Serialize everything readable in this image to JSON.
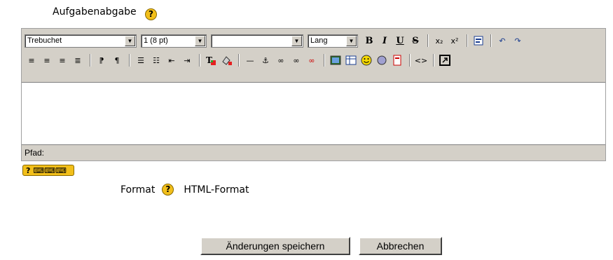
{
  "field": {
    "label": "Aufgabenabgabe",
    "help_icon": "?"
  },
  "toolbar": {
    "font_family": "Trebuchet",
    "font_size": "1 (8 pt)",
    "heading": "",
    "lang": "Lang",
    "bold": "B",
    "italic": "I",
    "underline": "U",
    "strike": "S",
    "subscript": "x₂",
    "superscript": "x²"
  },
  "editor": {
    "path_label": "Pfad:"
  },
  "keyboard_help": {
    "label": "? ⌨⌨⌨"
  },
  "format": {
    "label": "Format",
    "help_icon": "?",
    "value": "HTML-Format"
  },
  "actions": {
    "save": "Änderungen speichern",
    "cancel": "Abbrechen"
  }
}
